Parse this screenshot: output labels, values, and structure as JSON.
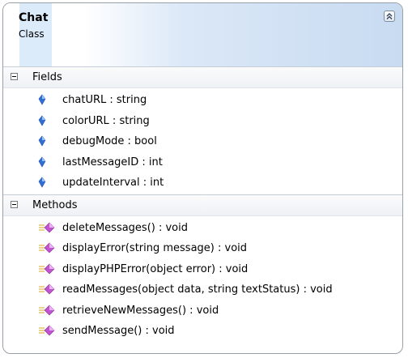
{
  "class": {
    "name": "Chat",
    "stereotype": "Class"
  },
  "sections": {
    "fields_label": "Fields",
    "methods_label": "Methods"
  },
  "fields": [
    "chatURL : string",
    "colorURL : string",
    "debugMode : bool",
    "lastMessageID : int",
    "updateInterval : int"
  ],
  "methods": [
    "deleteMessages() : void",
    "displayError(string message) : void",
    "displayPHPError(object error) : void",
    "readMessages(object data, string textStatus) : void",
    "retrieveNewMessages() : void",
    "sendMessage() : void"
  ],
  "colors": {
    "field_icon": "#2f6fd6",
    "method_icon": "#c054d0",
    "border": "#9aa0a8"
  },
  "icons": {
    "collapse": "double-chevron-up-icon",
    "field": "field-diamond-icon",
    "method": "method-icon"
  }
}
